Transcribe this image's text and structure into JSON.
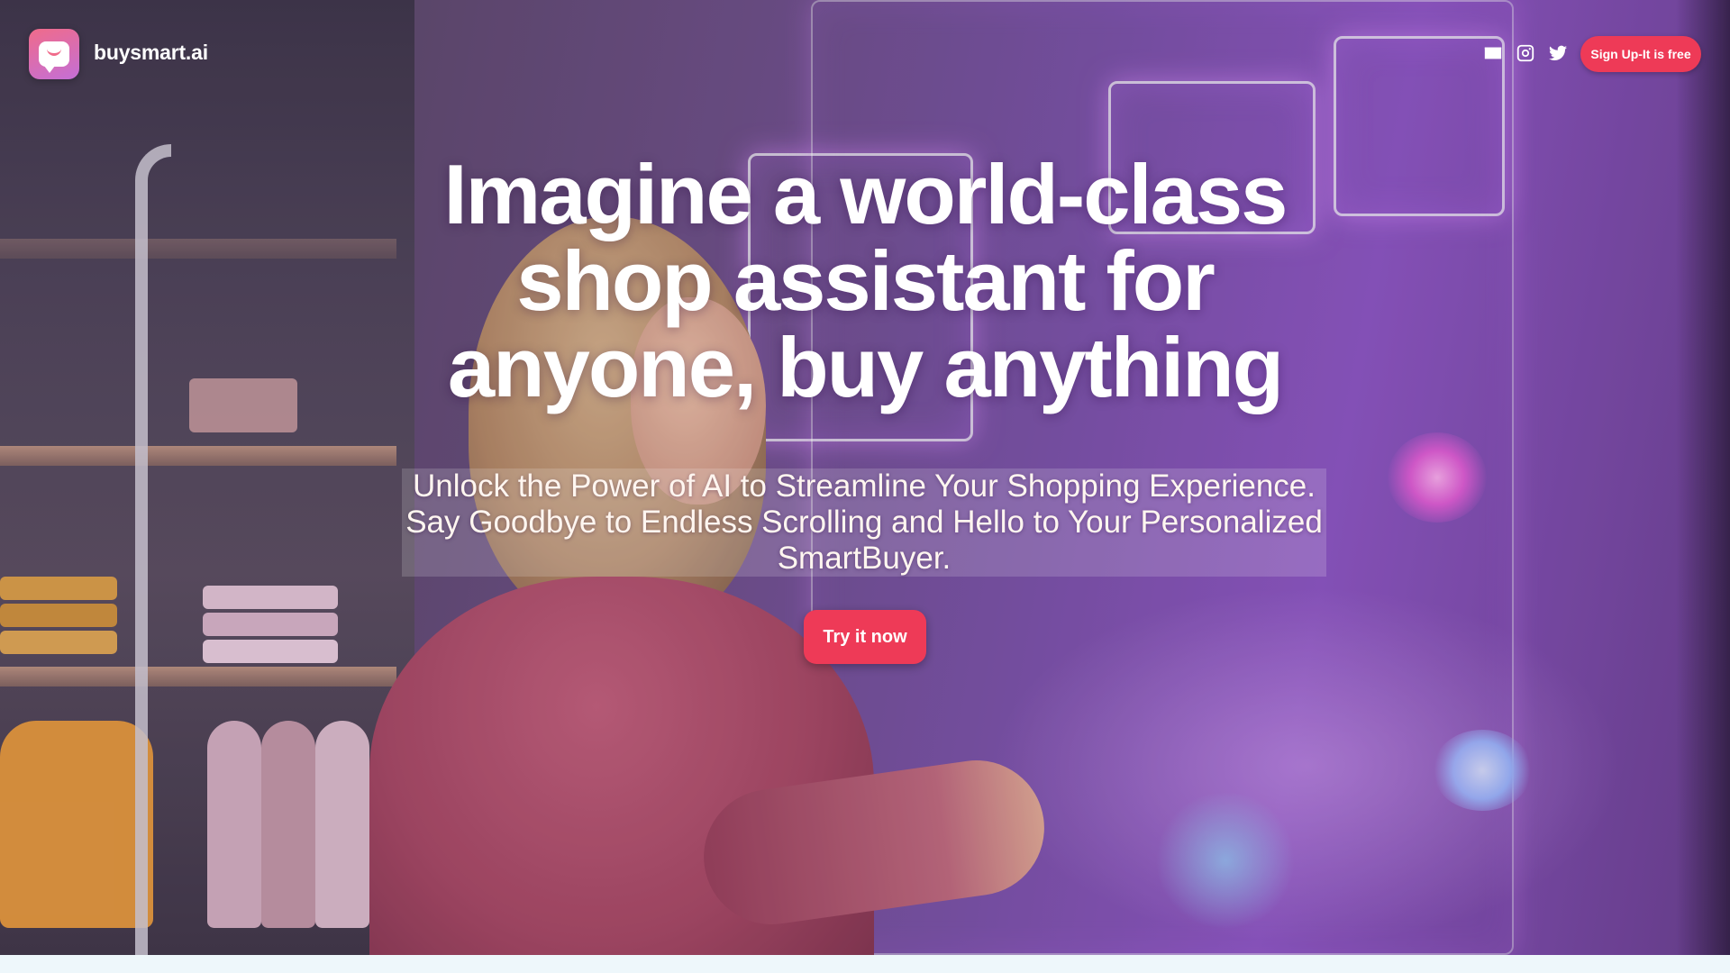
{
  "brand": {
    "name": "buysmart.ai"
  },
  "header": {
    "signup_label": "Sign Up-It is free",
    "icons": [
      "mail-icon",
      "instagram-icon",
      "twitter-icon"
    ]
  },
  "hero": {
    "headline": "Imagine a world-class shop assistant for anyone, buy anything",
    "subtext": "Unlock the Power of AI to Streamline Your Shopping Experience. Say Goodbye to Endless Scrolling and Hello to Your Personalized SmartBuyer.",
    "cta_label": "Try it now"
  },
  "colors": {
    "accent": "#ee3a57",
    "logo_gradient_start": "#f06b8a",
    "logo_gradient_end": "#c46fd6",
    "text": "#ffffff"
  }
}
